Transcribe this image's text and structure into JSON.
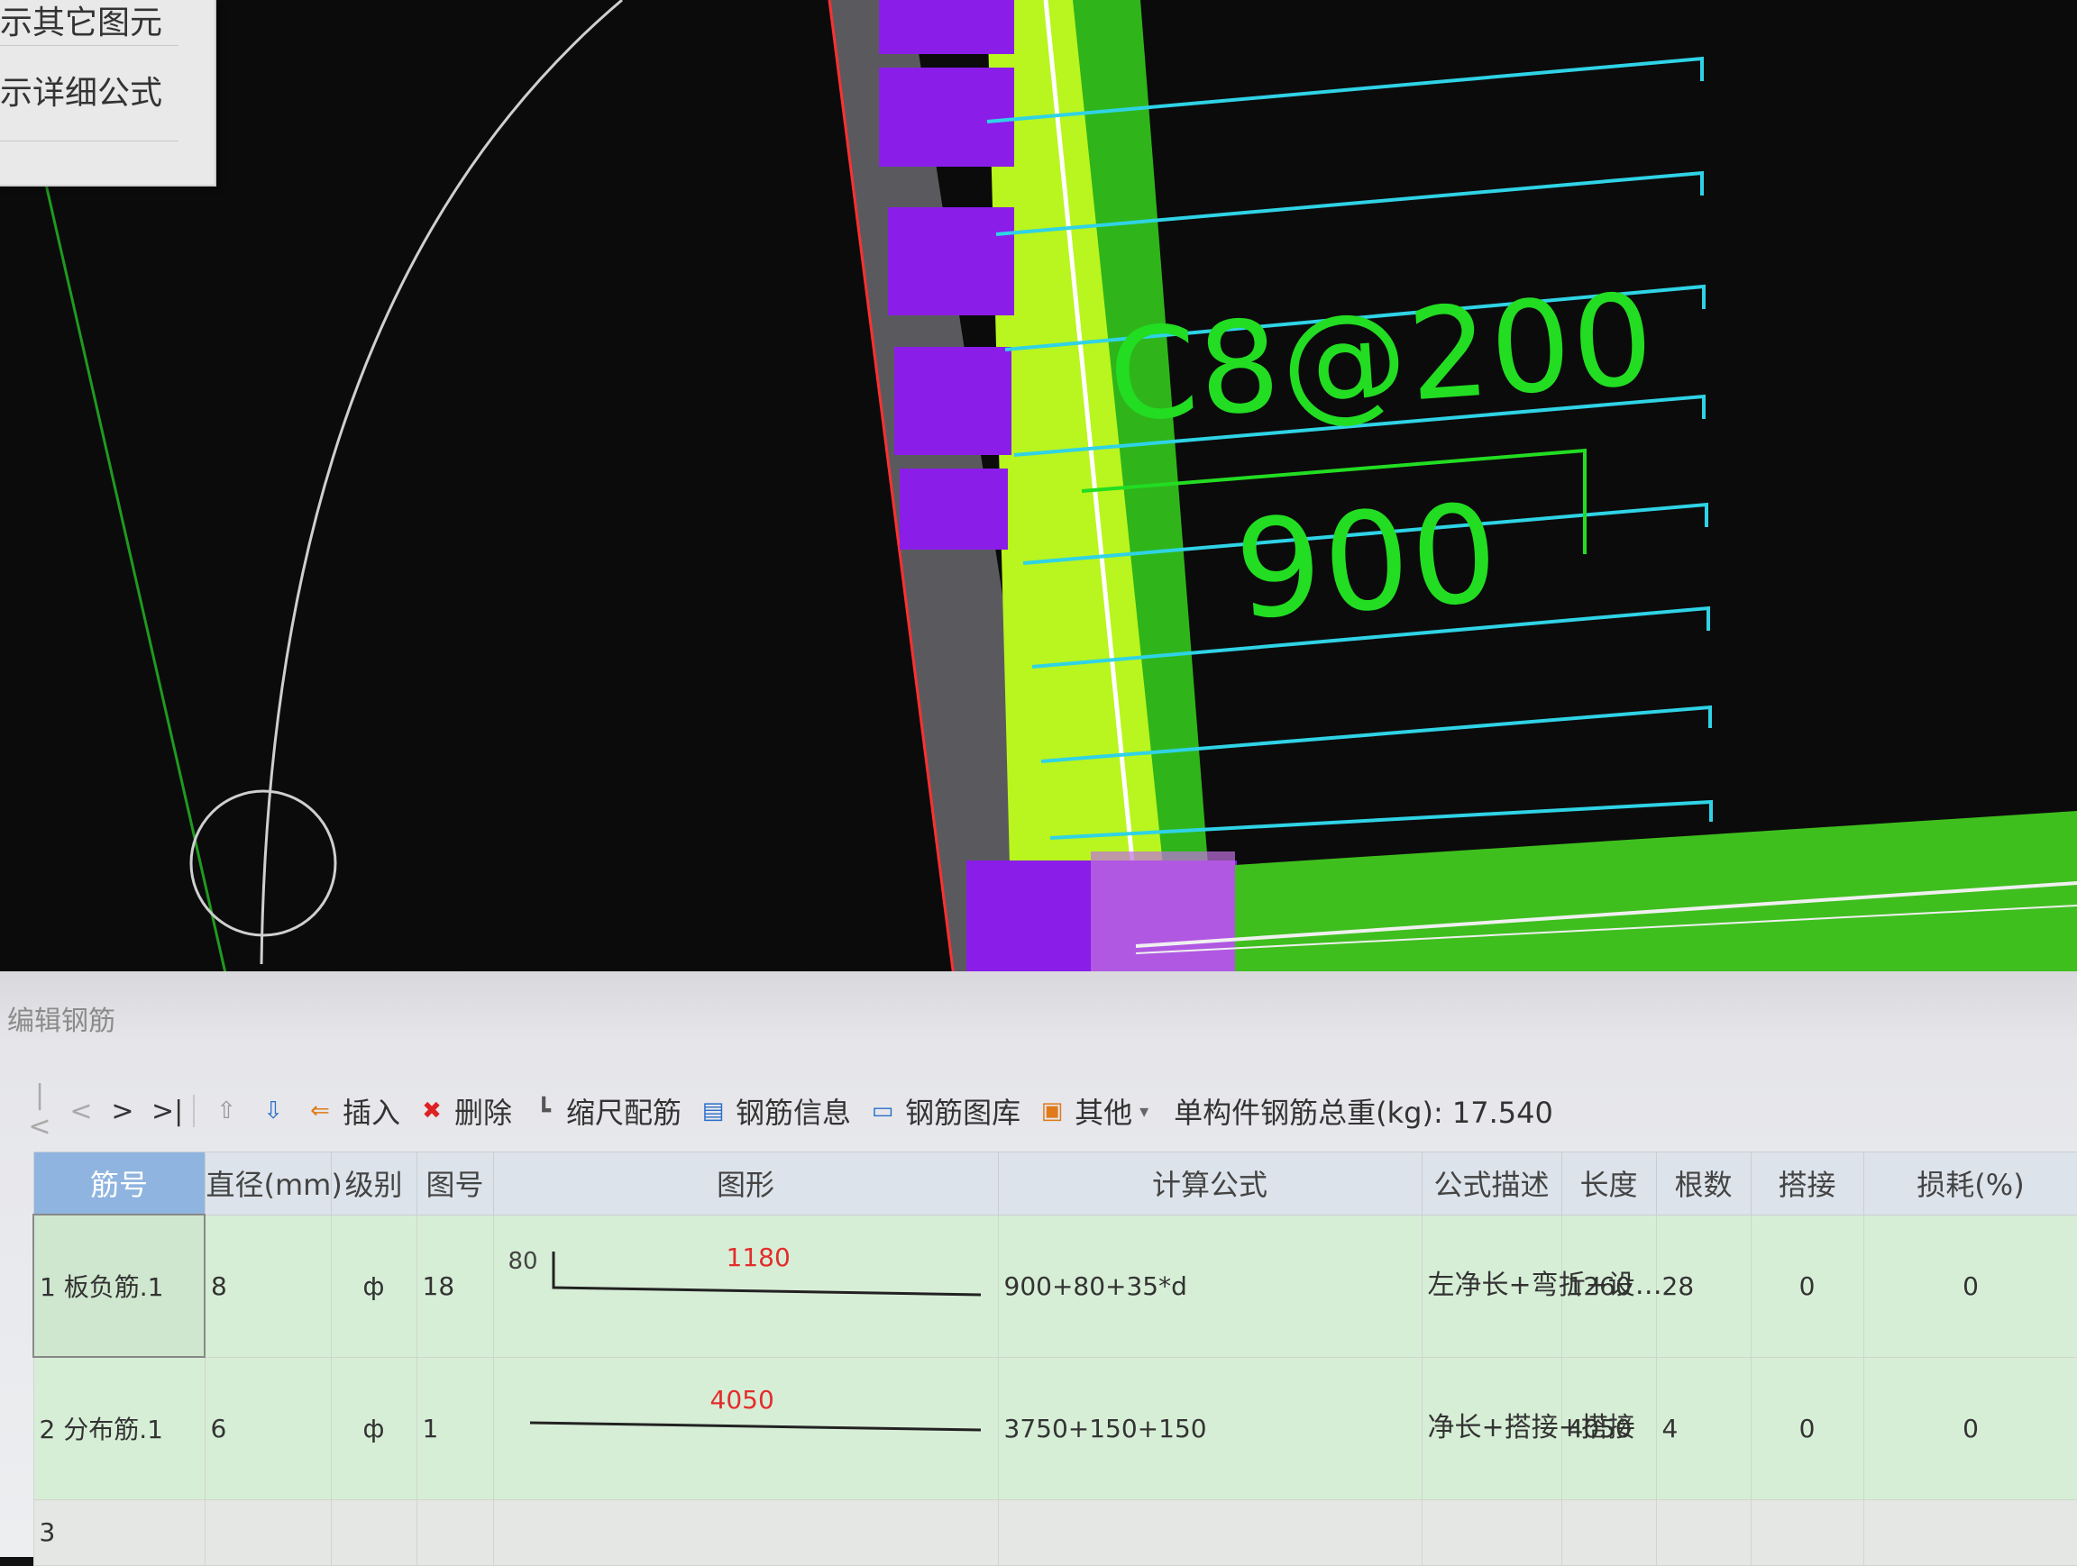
{
  "context_menu": {
    "items": [
      "示其它图元",
      "示详细公式"
    ]
  },
  "cad": {
    "rebar_label": "C8@200",
    "length_label": "900",
    "cursor_icon": "pan-navigate-icon"
  },
  "panel": {
    "title": "编辑钢筋",
    "toolbar": {
      "nav": [
        "|<",
        "<",
        ">",
        ">|"
      ],
      "buttons": [
        {
          "label": "插入",
          "icon": "insert-icon"
        },
        {
          "label": "删除",
          "icon": "delete-icon"
        },
        {
          "label": "缩尺配筋",
          "icon": "scale-rebar-icon"
        },
        {
          "label": "钢筋信息",
          "icon": "rebar-info-icon"
        },
        {
          "label": "钢筋图库",
          "icon": "rebar-library-icon"
        },
        {
          "label": "其他",
          "icon": "other-icon"
        }
      ],
      "total_weight_label": "单构件钢筋总重(kg): 17.540"
    },
    "columns": [
      "筋号",
      "直径(mm)",
      "级别",
      "图号",
      "图形",
      "计算公式",
      "公式描述",
      "长度",
      "根数",
      "搭接",
      "损耗(%)"
    ],
    "rows": [
      {
        "index": "1",
        "name": "板负筋.1",
        "diameter": "8",
        "grade": "ф",
        "figure_no": "18",
        "shape_left": "80",
        "shape_length": "1180",
        "formula": "900+80+35*d",
        "description": "左净长+弯折+设…",
        "length": "1260",
        "count": "28",
        "lap": "0",
        "loss": "0"
      },
      {
        "index": "2",
        "name": "分布筋.1",
        "diameter": "6",
        "grade": "ф",
        "figure_no": "1",
        "shape_left": "",
        "shape_length": "4050",
        "formula": "3750+150+150",
        "description": "净长+搭接+搭接",
        "length": "4050",
        "count": "4",
        "lap": "0",
        "loss": "0"
      },
      {
        "index": "3",
        "name": "",
        "diameter": "",
        "grade": "",
        "figure_no": "",
        "shape_left": "",
        "shape_length": "",
        "formula": "",
        "description": "",
        "length": "",
        "count": "",
        "lap": "",
        "loss": ""
      }
    ]
  },
  "colors": {
    "cad_bg": "#0b0b0b",
    "slab_green": "#3fbf1e",
    "wall_yellow": "#c8ff1e",
    "column_purple": "#8a1ee8",
    "rebar_cyan": "#2fd3e6",
    "grid_row_green": "#d7eed6",
    "dimension_red": "#e32d2d"
  }
}
